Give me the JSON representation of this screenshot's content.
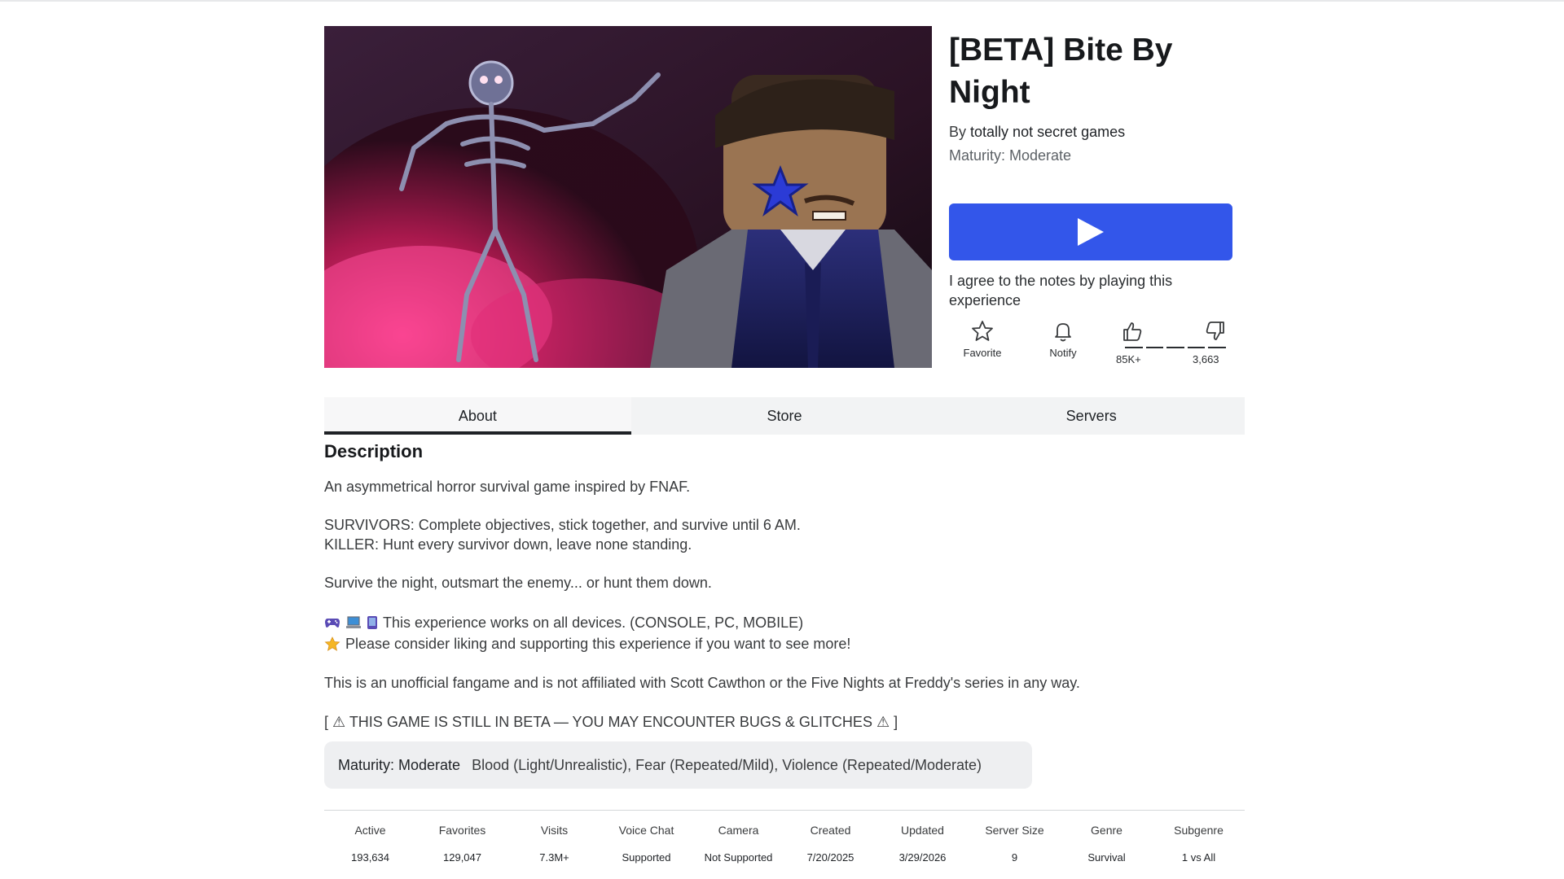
{
  "game": {
    "title": "[BETA] Bite By Night",
    "by_prefix": "By",
    "creator": "totally not secret games",
    "maturity": "Maturity: Moderate"
  },
  "play": {
    "agree_text": "I agree to the notes by playing this experience",
    "button_color": "#3356ea"
  },
  "actions": {
    "favorite_label": "Favorite",
    "notify_label": "Notify",
    "likes": "85K+",
    "dislikes": "3,663"
  },
  "tabs": [
    {
      "label": "About",
      "active": true
    },
    {
      "label": "Store",
      "active": false
    },
    {
      "label": "Servers",
      "active": false
    }
  ],
  "description": {
    "heading": "Description",
    "line1": "An asymmetrical horror survival game inspired by FNAF.",
    "line2": "SURVIVORS: Complete objectives, stick together, and survive until 6 AM.",
    "line3": "KILLER: Hunt every survivor down, leave none standing.",
    "line4": "Survive the night, outsmart the enemy... or hunt them down.",
    "line5": "This experience works on all devices. (CONSOLE, PC, MOBILE)",
    "line6": "Please consider liking and supporting this experience if you want to see more!",
    "line7": "This is an unofficial fangame and is not affiliated with Scott Cawthon or the Five Nights at Freddy's series in any way.",
    "line8": "[ ⚠ THIS GAME IS STILL IN BETA — YOU MAY ENCOUNTER BUGS & GLITCHES ⚠ ]"
  },
  "maturity_box": {
    "label": "Maturity: Moderate",
    "descriptors": "Blood (Light/Unrealistic), Fear (Repeated/Mild), Violence (Repeated/Moderate)"
  },
  "stats": [
    {
      "label": "Active",
      "value": "193,634"
    },
    {
      "label": "Favorites",
      "value": "129,047"
    },
    {
      "label": "Visits",
      "value": "7.3M+"
    },
    {
      "label": "Voice Chat",
      "value": "Supported"
    },
    {
      "label": "Camera",
      "value": "Not Supported"
    },
    {
      "label": "Created",
      "value": "7/20/2025"
    },
    {
      "label": "Updated",
      "value": "3/29/2026"
    },
    {
      "label": "Server Size",
      "value": "9"
    },
    {
      "label": "Genre",
      "value": "Survival"
    },
    {
      "label": "Subgenre",
      "value": "1 vs All"
    }
  ],
  "icons": {
    "play": "play-icon",
    "favorite": "star-icon",
    "notify": "bell-icon",
    "like": "thumbs-up-icon",
    "dislike": "thumbs-down-icon",
    "gamepad": "gamepad-icon",
    "laptop": "laptop-icon",
    "phone": "phone-icon",
    "star_emoji": "star-emoji-icon"
  }
}
